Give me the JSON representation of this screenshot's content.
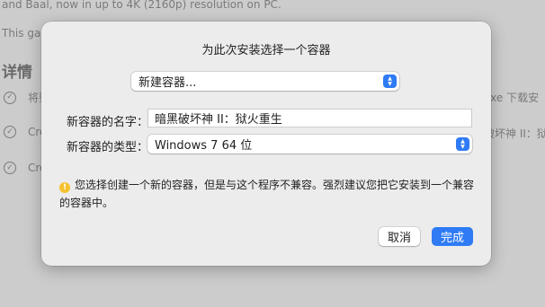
{
  "background": {
    "line1": "and Baal, now in up to 4K (2160p) resolution on PC.",
    "line2": "This ga",
    "heading": "详情",
    "items": [
      {
        "text": "将要",
        "right": "exe 下载安"
      },
      {
        "text": "Cro",
        "right": "破坏神 II：狱"
      },
      {
        "text": "Cro",
        "right": ""
      }
    ]
  },
  "dialog": {
    "title": "为此次安装选择一个容器",
    "container_select": "新建容器...",
    "name_label": "新容器的名字：",
    "name_value": "暗黑破坏神 II：狱火重生",
    "type_label": "新容器的类型：",
    "type_value": "Windows 7 64 位",
    "warning_icon": "!",
    "warning_text": "您选择创建一个新的容器，但是与这个程序不兼容。强烈建议您把它安装到一个兼容的容器中。",
    "cancel_label": "取消",
    "done_label": "完成"
  },
  "colors": {
    "accent": "#2f7bf5",
    "warning": "#f5c12e"
  }
}
